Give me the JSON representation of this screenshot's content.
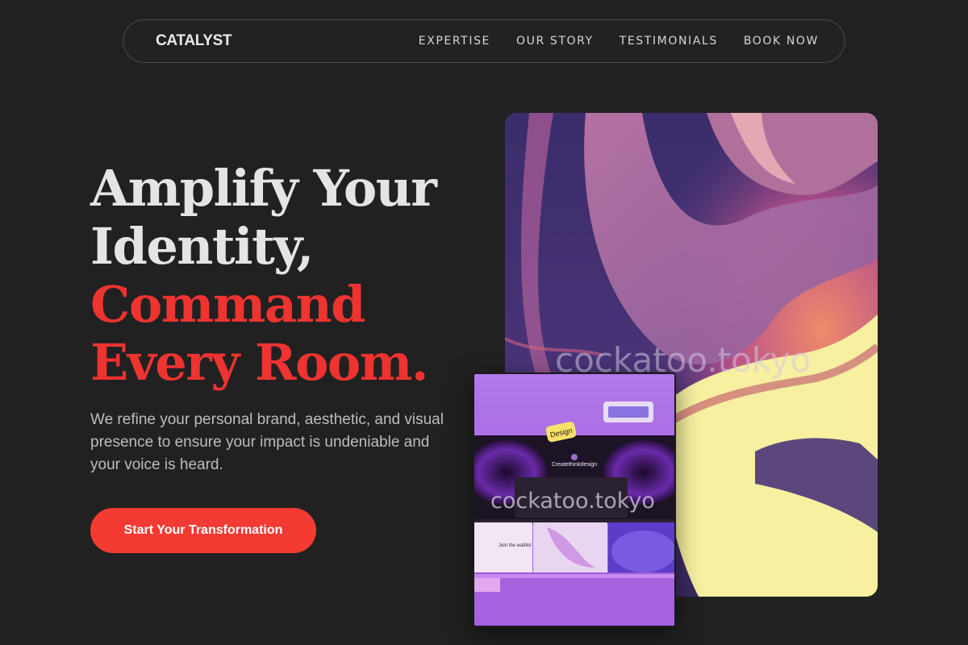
{
  "nav": {
    "brand": "CATALYST",
    "links": [
      "EXPERTISE",
      "OUR STORY",
      "TESTIMONIALS",
      "BOOK NOW"
    ]
  },
  "hero": {
    "headline_light": [
      "Amplify Your",
      "Identity,"
    ],
    "headline_accent": [
      "Command",
      "Every Room."
    ],
    "subtext": "We refine your personal brand, aesthetic, and visual presence to ensure your impact is undeniable and your voice is heard.",
    "cta_label": "Start Your Transformation"
  },
  "media": {
    "watermark": "cockatoo.tokyo",
    "mock_sticker": "Design",
    "mock_brand": "Createthinkdesign",
    "mock_waitlist": "Join the waitlist"
  },
  "colors": {
    "background": "#212121",
    "accent": "#ef3330",
    "cta": "#f33a33"
  }
}
